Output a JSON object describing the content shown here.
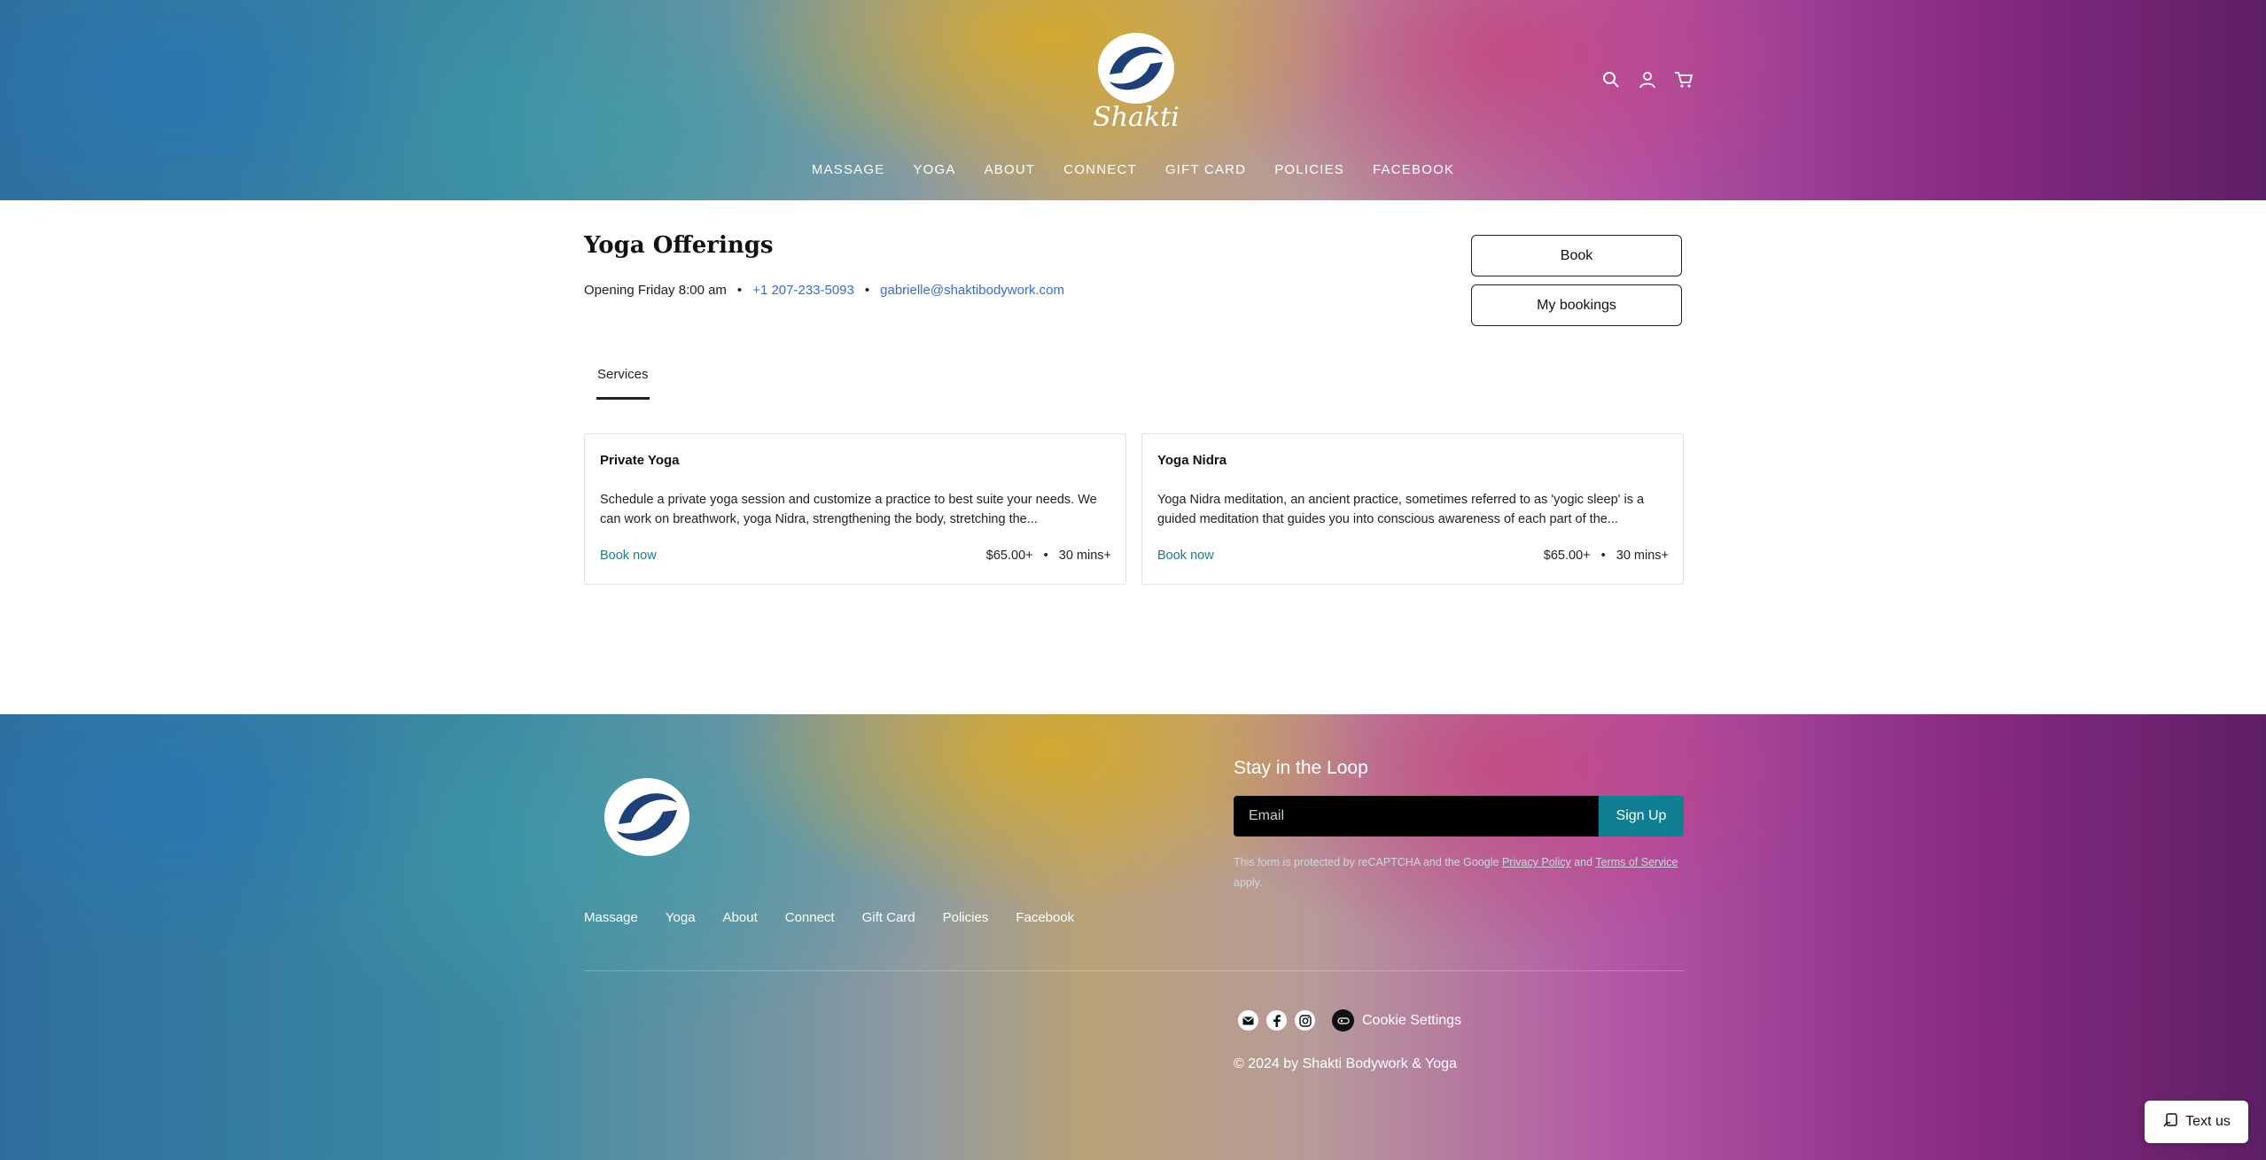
{
  "brand": {
    "name": "Shakti"
  },
  "header": {
    "nav": [
      "MASSAGE",
      "YOGA",
      "ABOUT",
      "CONNECT",
      "GIFT CARD",
      "POLICIES",
      "FACEBOOK"
    ],
    "icons": [
      "search-icon",
      "account-icon",
      "cart-icon"
    ]
  },
  "page": {
    "title": "Yoga Offerings",
    "opening": "Opening Friday 8:00 am",
    "bullet": "•",
    "phone": "+1 207-233-5093",
    "email": "gabrielle@shaktibodywork.com",
    "book_label": "Book",
    "my_bookings_label": "My bookings",
    "tab_label": "Services"
  },
  "services": [
    {
      "title": "Private Yoga",
      "description": "Schedule a private yoga session and customize a practice to best suite your needs. We can work on breathwork, yoga Nidra, strengthening the body, stretching the...",
      "book_label": "Book now",
      "price": "$65.00+",
      "duration": "30 mins+"
    },
    {
      "title": "Yoga Nidra",
      "description": "Yoga Nidra meditation, an ancient practice, sometimes referred to as 'yogic sleep' is a guided meditation that guides you into conscious awareness of each part of the...",
      "book_label": "Book now",
      "price": "$65.00+",
      "duration": "30 mins+"
    }
  ],
  "footer": {
    "nav": [
      "Massage",
      "Yoga",
      "About",
      "Connect",
      "Gift Card",
      "Policies",
      "Facebook"
    ],
    "newsletter_title": "Stay in the Loop",
    "email_placeholder": "Email",
    "signup_label": "Sign Up",
    "recaptcha_prefix": "This form is protected by reCAPTCHA and the Google",
    "privacy_link": "Privacy Policy",
    "and_text": "and",
    "terms_link": "Terms of Service",
    "apply_text": "apply.",
    "cookie_label": "Cookie Settings",
    "copyright": "© 2024 by Shakti Bodywork & Yoga",
    "social_icons": [
      "email-icon",
      "facebook-icon",
      "instagram-icon"
    ]
  },
  "chat": {
    "label": "Text us"
  },
  "colors": {
    "link": "#3b6bd4",
    "book_now": "#1a7c8c",
    "signup": "#0f7f91"
  }
}
